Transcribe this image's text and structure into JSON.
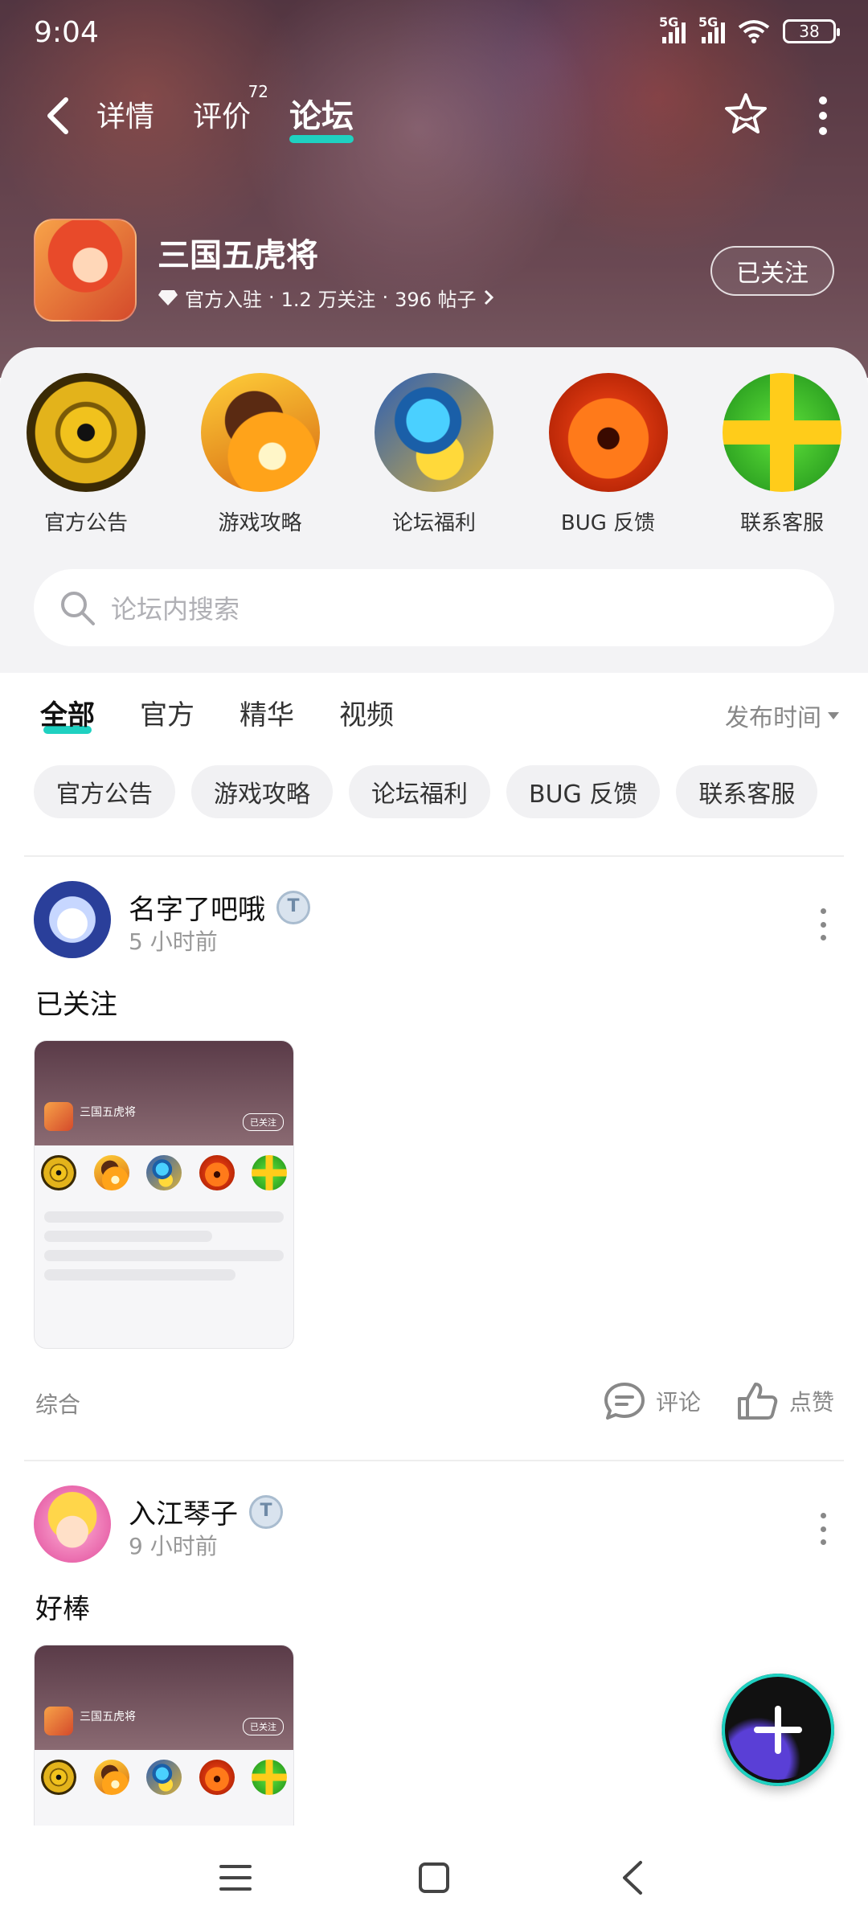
{
  "status": {
    "time": "9:04",
    "network1": "5G",
    "network2": "5G",
    "battery": "38"
  },
  "nav": {
    "tabs": [
      {
        "label": "详情"
      },
      {
        "label": "评价",
        "badge": "72"
      },
      {
        "label": "论坛"
      }
    ]
  },
  "game": {
    "title": "三国五虎将",
    "meta_official": "官方入驻",
    "meta_followers": "1.2 万关注",
    "meta_posts": "396 帖子",
    "follow_label": "已关注"
  },
  "categories": [
    {
      "label": "官方公告",
      "icon": "eye-emblem-icon"
    },
    {
      "label": "游戏攻略",
      "icon": "strategy-icon"
    },
    {
      "label": "论坛福利",
      "icon": "gift-icon"
    },
    {
      "label": "BUG 反馈",
      "icon": "pumpkin-icon"
    },
    {
      "label": "联系客服",
      "icon": "plus-cross-icon"
    }
  ],
  "search": {
    "placeholder": "论坛内搜索"
  },
  "filter_tabs": [
    "全部",
    "官方",
    "精华",
    "视频"
  ],
  "sort_label": "发布时间",
  "chips": [
    "官方公告",
    "游戏攻略",
    "论坛福利",
    "BUG 反馈",
    "联系客服"
  ],
  "posts": [
    {
      "author": "名字了吧哦",
      "time": "5 小时前",
      "text": "已关注",
      "tag": "综合",
      "comment_label": "评论",
      "like_label": "点赞"
    },
    {
      "author": "入江琴子",
      "time": "9 小时前",
      "text": "好棒"
    }
  ],
  "colors": {
    "accent": "#1fd1c1"
  }
}
